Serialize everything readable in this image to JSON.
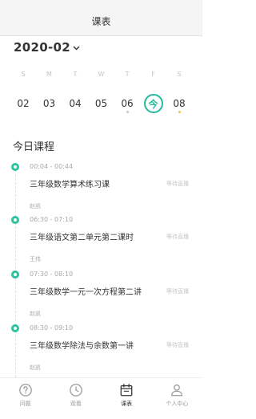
{
  "header": {
    "title": "课表"
  },
  "calendar": {
    "month": "2020-02",
    "weekdays": [
      "S",
      "M",
      "T",
      "W",
      "T",
      "F",
      "S"
    ],
    "dates": [
      {
        "label": "02",
        "dot": false
      },
      {
        "label": "03",
        "dot": false
      },
      {
        "label": "04",
        "dot": false
      },
      {
        "label": "05",
        "dot": false
      },
      {
        "label": "06",
        "dot": true,
        "dot_color": "#c8c8c8"
      },
      {
        "label": "今",
        "today": true
      },
      {
        "label": "08",
        "dot": true,
        "dot_color": "#f5c341"
      }
    ]
  },
  "section": {
    "title": "今日课程"
  },
  "courses": [
    {
      "time": "00:04 - 00:44",
      "title": "三年级数学算术练习课",
      "teacher": "赵凯",
      "status": "等待直播"
    },
    {
      "time": "06:30 - 07:10",
      "title": "三年级语文第二单元第二课时",
      "teacher": "王伟",
      "status": "等待直播"
    },
    {
      "time": "07:30 - 08:10",
      "title": "三年级数学一元一次方程第二讲",
      "teacher": "赵凯",
      "status": "等待直播"
    },
    {
      "time": "08:30 - 09:10",
      "title": "三年级数学除法与余数第一讲",
      "teacher": "赵凯",
      "status": "等待直播"
    }
  ],
  "tabbar": {
    "items": [
      {
        "label": "问题",
        "icon": "question-icon",
        "active": false
      },
      {
        "label": "观看",
        "icon": "clock-icon",
        "active": false
      },
      {
        "label": "课表",
        "icon": "calendar-icon",
        "active": true
      },
      {
        "label": "个人中心",
        "icon": "user-icon",
        "active": false
      }
    ]
  },
  "colors": {
    "accent": "#25b89a",
    "dot_yellow": "#f5c341"
  }
}
